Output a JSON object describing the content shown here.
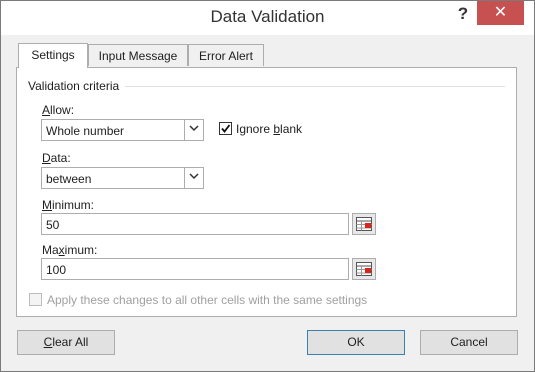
{
  "window": {
    "title": "Data Validation",
    "help_label": "?",
    "close_label": "✕",
    "close_color": "#c75050"
  },
  "tabs": [
    {
      "label": "Settings",
      "active": true
    },
    {
      "label": "Input Message",
      "active": false
    },
    {
      "label": "Error Alert",
      "active": false
    }
  ],
  "criteria": {
    "group_label": "Validation criteria",
    "allow": {
      "label_pre": "",
      "label_mnemonic": "A",
      "label_post": "llow:",
      "value": "Whole number"
    },
    "ignore_blank": {
      "label_pre": "Ignore ",
      "label_mnemonic": "b",
      "label_post": "lank",
      "checked": true
    },
    "data": {
      "label_pre": "",
      "label_mnemonic": "D",
      "label_post": "ata:",
      "value": "between"
    },
    "minimum": {
      "label_pre": "",
      "label_mnemonic": "M",
      "label_post": "inimum:",
      "value": "50"
    },
    "maximum": {
      "label_pre": "Ma",
      "label_mnemonic": "x",
      "label_post": "imum:",
      "value": "100"
    }
  },
  "apply_all": {
    "label": "Apply these changes to all other cells with the same settings",
    "checked": false,
    "enabled": false
  },
  "buttons": {
    "clear_all": {
      "pre": "",
      "mnemonic": "C",
      "post": "lear All"
    },
    "ok": "OK",
    "cancel": "Cancel"
  },
  "icons": {
    "dropdown": "chevron-down-icon",
    "range_selector": "collapse-dialog-icon"
  }
}
